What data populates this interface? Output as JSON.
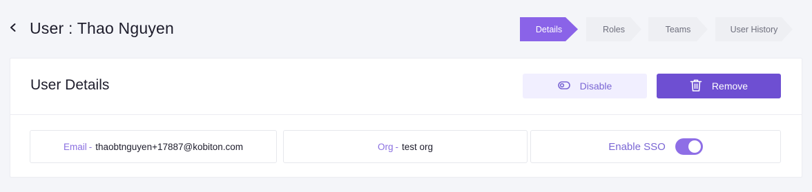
{
  "header": {
    "title": "User : Thao Nguyen"
  },
  "stepper": {
    "steps": [
      {
        "label": "Details",
        "active": true
      },
      {
        "label": "Roles",
        "active": false
      },
      {
        "label": "Teams",
        "active": false
      },
      {
        "label": "User History",
        "active": false
      }
    ]
  },
  "card": {
    "title": "User Details",
    "disable_label": "Disable",
    "remove_label": "Remove",
    "email_label": "Email",
    "email_sep": "-",
    "email_value": "thaobtnguyen+17887@kobiton.com",
    "org_label": "Org",
    "org_sep": "-",
    "org_value": "test org",
    "sso_label": "Enable SSO",
    "sso_enabled": true
  },
  "colors": {
    "accent": "#8a63e8",
    "button_primary": "#6e4fd2",
    "button_soft": "#f1efff",
    "step_inactive": "#eeeff3"
  },
  "icons": {
    "back": "chevron-left-icon",
    "disable": "toggle-off-icon",
    "remove": "trash-icon"
  }
}
